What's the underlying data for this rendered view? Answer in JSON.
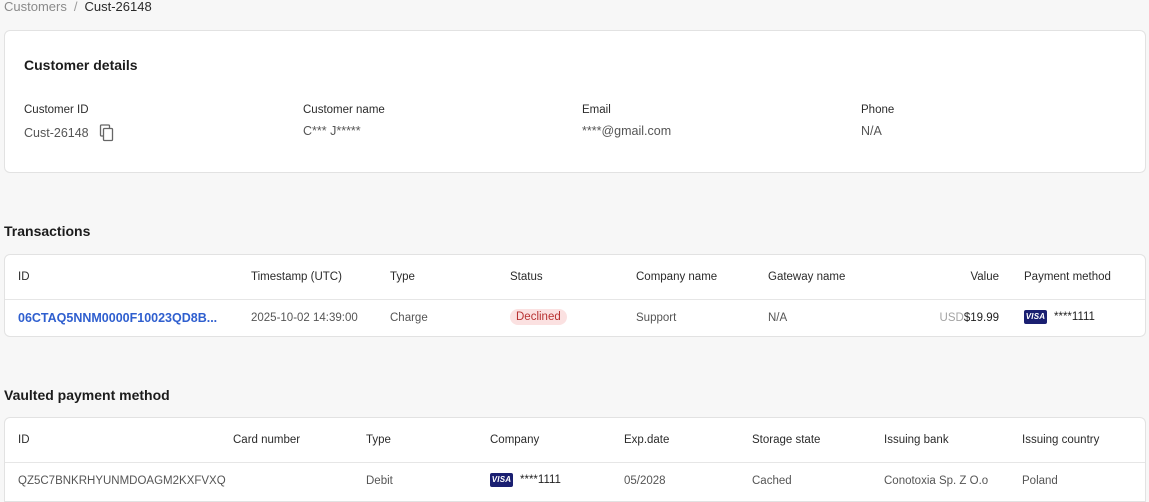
{
  "breadcrumb": {
    "parent": "Customers",
    "separator": "/",
    "current": "Cust-26148"
  },
  "customer_details": {
    "title": "Customer details",
    "fields": [
      {
        "label": "Customer ID",
        "value": "Cust-26148"
      },
      {
        "label": "Customer name",
        "value": "C*** J*****"
      },
      {
        "label": "Email",
        "value": "****@gmail.com"
      },
      {
        "label": "Phone",
        "value": "N/A"
      }
    ]
  },
  "transactions": {
    "title": "Transactions",
    "columns": [
      "ID",
      "Timestamp (UTC)",
      "Type",
      "Status",
      "Company name",
      "Gateway name",
      "Value",
      "Payment method"
    ],
    "rows": [
      {
        "id": "06CTAQ5NNM0000F10023QD8B...",
        "timestamp": "2025-10-02 14:39:00",
        "type": "Charge",
        "status": "Declined",
        "company": "Support",
        "gateway": "N/A",
        "currency": "USD",
        "amount": "$19.99",
        "card_brand": "VISA",
        "card_masked": "****1111"
      }
    ]
  },
  "vaulted": {
    "title": "Vaulted payment method",
    "columns": [
      "ID",
      "Card number",
      "Type",
      "Company",
      "Exp.date",
      "Storage state",
      "Issuing bank",
      "Issuing country"
    ],
    "rows": [
      {
        "id": "QZ5C7BNKRHYUNMDOAGM2KXFVXQ",
        "card_number": "",
        "type": "Debit",
        "card_brand": "VISA",
        "card_masked": "****1111",
        "exp_date": "05/2028",
        "storage_state": "Cached",
        "issuing_bank": "Conotoxia Sp. Z O.o",
        "issuing_country": "Poland"
      }
    ]
  },
  "colors": {
    "link": "#2f5fcf",
    "declined_bg": "#fbe1e1",
    "declined_text": "#b83232",
    "visa": "#1a1f71"
  },
  "icons": {
    "copy": "copy-icon"
  }
}
